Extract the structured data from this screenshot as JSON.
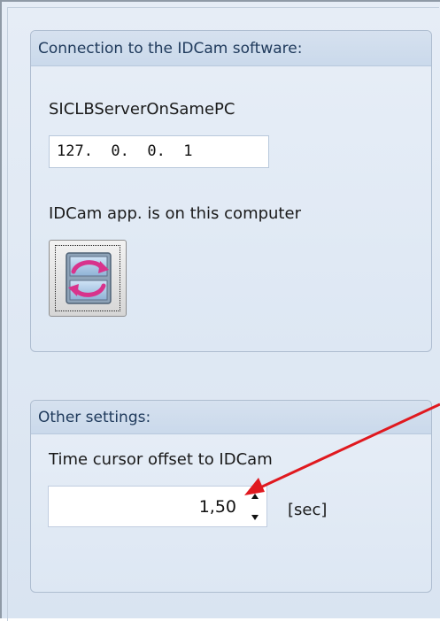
{
  "connection_group": {
    "header": "Connection to the IDCam software:",
    "server_label": "SICLBServerOnSamePC",
    "ip_value": "127.  0.  0.  1",
    "app_label": "IDCam app. is on this computer",
    "sync_button_icon": "sync-icon"
  },
  "other_group": {
    "header": "Other settings:",
    "time_label": "Time cursor offset to IDCam",
    "time_value": "1,50",
    "unit": "[sec]",
    "spin_up_icon": "chevron-up-icon",
    "spin_down_icon": "chevron-down-icon"
  },
  "annotation": {
    "arrow_color": "#e0191f"
  }
}
